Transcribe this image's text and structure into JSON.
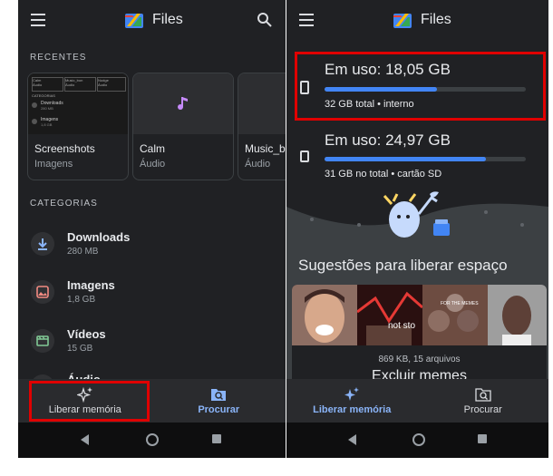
{
  "left": {
    "app_title": "Files",
    "recent_label": "RECENTES",
    "categories_label": "CATEGORIAS",
    "recent": [
      {
        "name": "Screenshots",
        "type": "Imagens"
      },
      {
        "name": "Calm",
        "type": "Áudio"
      },
      {
        "name": "Music_b",
        "type": "Áudio"
      }
    ],
    "mini_grid": {
      "cells": [
        {
          "name": "Calm",
          "sub": "Áudio"
        },
        {
          "name": "Music_bon",
          "sub": "Áudio"
        },
        {
          "name": "Nudge",
          "sub": "Áudio"
        }
      ],
      "cat_label": "CATEGORIAS",
      "items": [
        {
          "name": "Downloads",
          "sub": "280 MB"
        },
        {
          "name": "Imagens",
          "sub": "1,8 GB"
        }
      ]
    },
    "categories": [
      {
        "name": "Downloads",
        "size": "280 MB"
      },
      {
        "name": "Imagens",
        "size": "1,8 GB"
      },
      {
        "name": "Vídeos",
        "size": "15 GB"
      },
      {
        "name": "Áudio",
        "size": ""
      }
    ],
    "nav": {
      "free_up": "Liberar memória",
      "browse": "Procurar"
    }
  },
  "right": {
    "app_title": "Files",
    "storage": [
      {
        "title": "Em uso: 18,05 GB",
        "sub": "32 GB total • interno",
        "used_fraction": 0.56
      },
      {
        "title": "Em uso: 24,97 GB",
        "sub": "31 GB no total • cartão SD",
        "used_fraction": 0.8
      }
    ],
    "suggestions_title": "Sugestões para liberar espaço",
    "meme_caption": "not sto",
    "meme_panel_text": "FOR THE MEMES",
    "meme_info": "869 KB, 15 arquivos",
    "meme_action": "Excluir memes",
    "nav": {
      "free_up": "Liberar memória",
      "browse": "Procurar"
    }
  },
  "colors": {
    "accent_blue": "#8ab4f8",
    "highlight_red": "#e00000",
    "bar_blue": "#4285f4"
  }
}
